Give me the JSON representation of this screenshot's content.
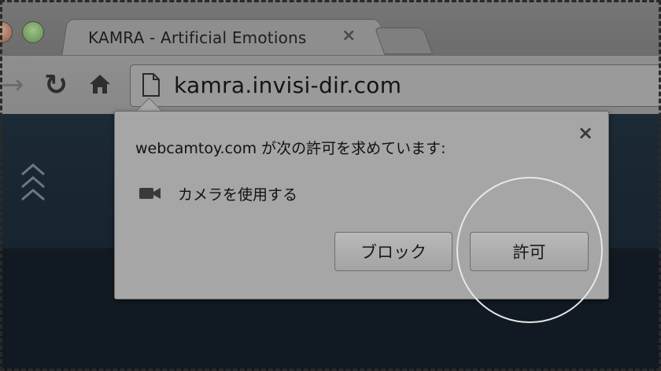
{
  "tab": {
    "title": "KAMRA - Artificial Emotions",
    "close_glyph": "×"
  },
  "toolbar": {
    "url": "kamra.invisi-dir.com",
    "forward_icon": "arrow-right-icon",
    "reload_icon": "reload-icon",
    "home_icon": "home-icon",
    "page_icon": "document-icon"
  },
  "permission_prompt": {
    "message": "webcamtoy.com が次の許可を求めています:",
    "close_glyph": "×",
    "permission_label": "カメラを使用する",
    "permission_icon": "camera-icon",
    "block_label": "ブロック",
    "allow_label": "許可"
  },
  "colors": {
    "page_background": "#17222c",
    "chrome_background": "#8c8c8c",
    "bubble_background": "#a6a6a6",
    "highlight_ring": "#e8e8e8"
  }
}
